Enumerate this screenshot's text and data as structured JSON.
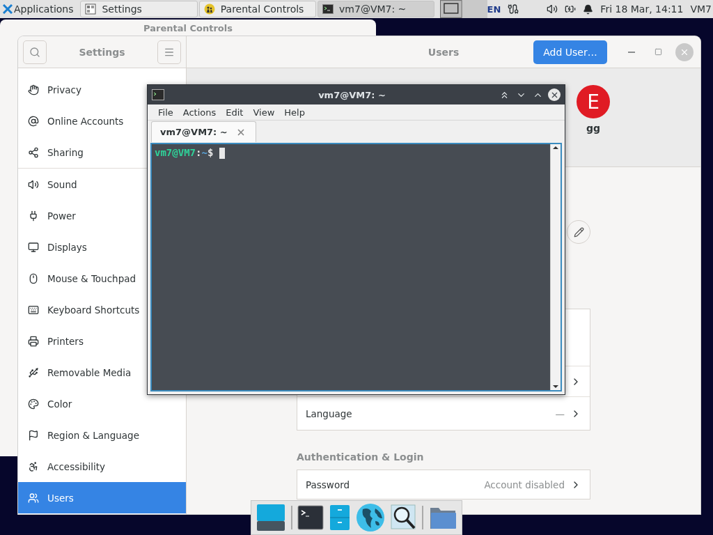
{
  "panel": {
    "apps_menu": "Applications",
    "tasks": [
      {
        "label": "Settings",
        "selected": false
      },
      {
        "label": "Parental Controls",
        "selected": false
      },
      {
        "label": "vm7@VM7: ~",
        "selected": true
      }
    ],
    "keyboard_layout": "EN",
    "clock": "Fri 18 Mar, 14:11",
    "user": "VM7"
  },
  "background_window": {
    "title": "Parental Controls"
  },
  "settings": {
    "title": "Settings",
    "page_title": "Users",
    "add_button": "Add User…",
    "sidebar": [
      {
        "label": "Privacy",
        "selected": false
      },
      {
        "label": "Online Accounts",
        "selected": false
      },
      {
        "label": "Sharing",
        "selected": false
      },
      {
        "label": "Sound",
        "selected": false
      },
      {
        "label": "Power",
        "selected": false
      },
      {
        "label": "Displays",
        "selected": false
      },
      {
        "label": "Mouse & Touchpad",
        "selected": false
      },
      {
        "label": "Keyboard Shortcuts",
        "selected": false
      },
      {
        "label": "Printers",
        "selected": false
      },
      {
        "label": "Removable Media",
        "selected": false
      },
      {
        "label": "Color",
        "selected": false
      },
      {
        "label": "Region & Language",
        "selected": false
      },
      {
        "label": "Accessibility",
        "selected": false
      },
      {
        "label": "Users",
        "selected": true
      }
    ],
    "user_strip": {
      "avatar_initial": "E",
      "name": "gg"
    },
    "account_rows": [
      {
        "label": "Language",
        "value": "—"
      }
    ],
    "auth_heading": "Authentication & Login",
    "auth_rows": [
      {
        "label": "Password",
        "value": "Account disabled"
      }
    ]
  },
  "terminal": {
    "title": "vm7@VM7: ~",
    "menu": [
      "File",
      "Actions",
      "Edit",
      "View",
      "Help"
    ],
    "tabs": [
      {
        "label": "vm7@VM7: ~",
        "selected": true
      }
    ],
    "prompt": {
      "user_host": "vm7@VM7",
      "separator": ":",
      "path": "~",
      "symbol": "$"
    }
  }
}
